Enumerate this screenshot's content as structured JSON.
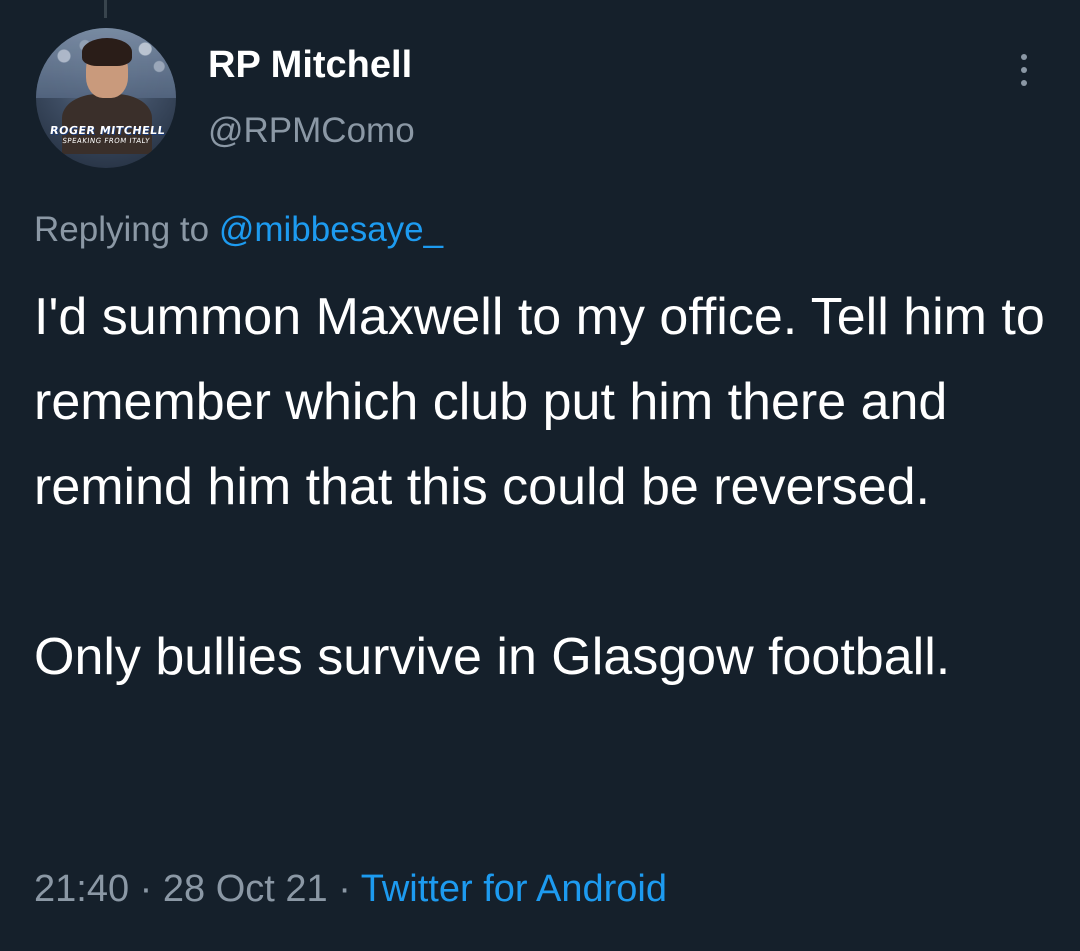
{
  "colors": {
    "background": "#15202b",
    "primary_text": "#ffffff",
    "secondary_text": "#8b98a5",
    "accent": "#1d9bf0"
  },
  "author": {
    "display_name": "RP Mitchell",
    "handle": "@RPMComo",
    "avatar_caption_line1": "ROGER MITCHELL",
    "avatar_caption_line2": "SPEAKING FROM ITALY"
  },
  "reply": {
    "prefix": "Replying to",
    "mention": "@mibbesaye_"
  },
  "tweet": {
    "paragraphs": [
      "I'd summon Maxwell to my office. Tell him to remember which club put him there and remind him that this could be reversed.",
      "Only bullies survive in Glasgow football."
    ]
  },
  "meta": {
    "time": "21:40",
    "separator": "·",
    "date": "28 Oct 21",
    "source": "Twitter for Android"
  },
  "icons": {
    "more": "more-vertical-icon"
  }
}
